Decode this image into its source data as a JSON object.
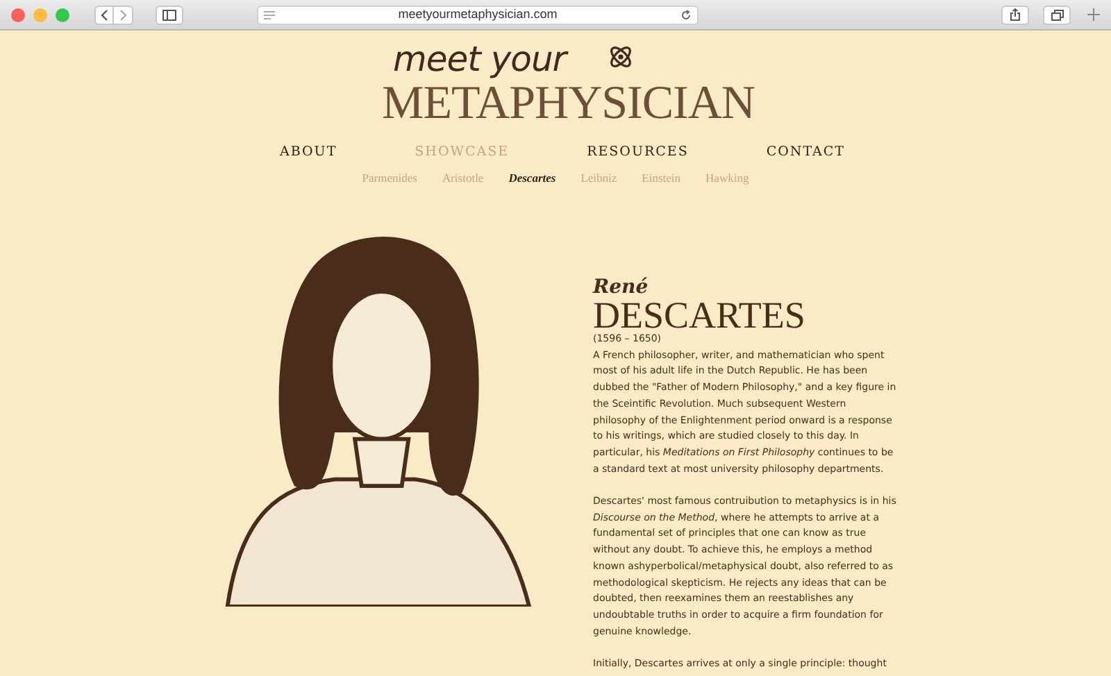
{
  "browser": {
    "url": "meetyourmetaphysician.com"
  },
  "logo": {
    "line_1": "meet your",
    "line_2": "METAPHYSICIAN"
  },
  "nav": [
    {
      "label": "ABOUT",
      "selected": false
    },
    {
      "label": "SHOWCASE",
      "selected": true
    },
    {
      "label": "RESOURCES",
      "selected": false
    },
    {
      "label": "CONTACT",
      "selected": false
    }
  ],
  "subnav": [
    {
      "label": "Parmenides",
      "selected": false
    },
    {
      "label": "Aristotle",
      "selected": false
    },
    {
      "label": "Descartes",
      "selected": true
    },
    {
      "label": "Leibniz",
      "selected": false
    },
    {
      "label": "Einstein",
      "selected": false
    },
    {
      "label": "Hawking",
      "selected": false
    }
  ],
  "profile": {
    "first_name": "René",
    "last_name": "DESCARTES",
    "dates": "(1596 – 1650)",
    "paragraphs": [
      "A French philosopher, writer, and mathematician who spent most of his adult life in the Dutch Republic. He has been dubbed the \"Father of Modern Philosophy,\" and a key figure in the Sceintific Revolution. Much subsequent Western philosophy of the Enlightenment period onward is a response to his writings, which are studied closely to this day. In particular, his *Meditations on First Philosophy* continues to be a standard text at most university philosophy departments.",
      "Descartes' most famous contruibution to metaphysics is in his *Discourse on the Method*, where he attempts to arrive at a fundamental set of principles that one can know as true without any doubt. To achieve this, he employs a method known ashyperbolical/metaphysical doubt, also referred to as methodological skepticism. He rejects any ideas that can be doubted, then reexamines them an reestablishes any undoubtable truths in order to acquire a firm foundation for genuine knowledge.",
      "Initially, Descartes arrives at only a single principle: thought"
    ]
  }
}
